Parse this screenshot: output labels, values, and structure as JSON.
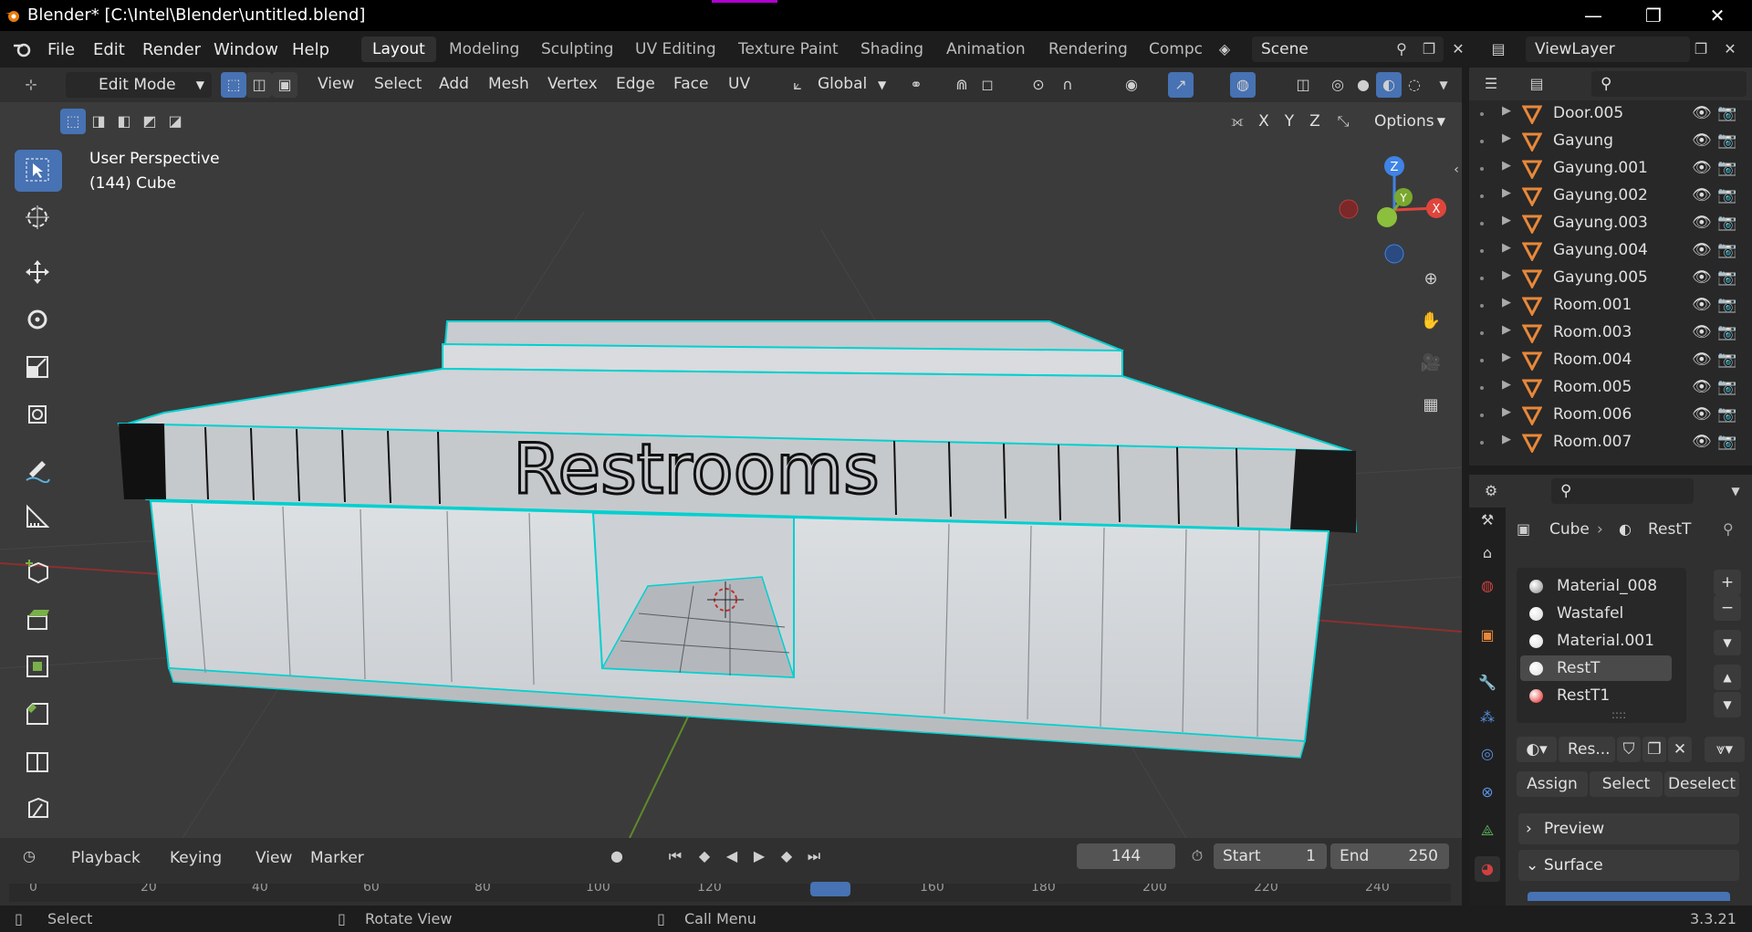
{
  "window": {
    "title": "Blender* [C:\\Intel\\Blender\\untitled.blend]",
    "minimize": "—",
    "maximize": "❐",
    "close": "✕"
  },
  "menu": [
    "File",
    "Edit",
    "Render",
    "Window",
    "Help"
  ],
  "workspaces": [
    "Layout",
    "Modeling",
    "Sculpting",
    "UV Editing",
    "Texture Paint",
    "Shading",
    "Animation",
    "Rendering",
    "Compc"
  ],
  "active_workspace": "Layout",
  "scene": "Scene",
  "view_layer": "ViewLayer",
  "viewport_header": {
    "mode": "Edit Mode",
    "menus": [
      "View",
      "Select",
      "Add",
      "Mesh",
      "Vertex",
      "Edge",
      "Face",
      "UV"
    ],
    "transform_orientation": "Global",
    "options": "Options",
    "axes": [
      "X",
      "Y",
      "Z"
    ]
  },
  "viewport": {
    "perspective": "User Perspective",
    "object": "(144) Cube",
    "sign_text": "Restrooms",
    "gizmo": {
      "x": "X",
      "y": "Y",
      "z": "Z"
    }
  },
  "outliner": {
    "items": [
      "Door.005",
      "Gayung",
      "Gayung.001",
      "Gayung.002",
      "Gayung.003",
      "Gayung.004",
      "Gayung.005",
      "Room.001",
      "Room.003",
      "Room.004",
      "Room.005",
      "Room.006",
      "Room.007"
    ]
  },
  "properties": {
    "breadcrumb_object": "Cube",
    "breadcrumb_material": "RestT",
    "material_slots": [
      {
        "name": "Material_008",
        "color": "#8a8a8a"
      },
      {
        "name": "Wastafel",
        "color": "#d8d8d8"
      },
      {
        "name": "Material.001",
        "color": "#dcdcdc"
      },
      {
        "name": "RestT",
        "color": "#e0e0e0"
      },
      {
        "name": "RestT1",
        "color": "#e01818"
      }
    ],
    "active_slot": "RestT",
    "material_field": "Res...",
    "assign": "Assign",
    "select": "Select",
    "deselect": "Deselect",
    "panels": [
      "Preview",
      "Surface"
    ]
  },
  "timeline": {
    "menus": [
      "Playback",
      "Keying",
      "View",
      "Marker"
    ],
    "current_frame": "144",
    "start_label": "Start",
    "start": "1",
    "end_label": "End",
    "end": "250",
    "ruler": [
      "0",
      "20",
      "40",
      "60",
      "80",
      "100",
      "120",
      "140",
      "160",
      "180",
      "200",
      "220",
      "240"
    ]
  },
  "statusbar": {
    "select": "Select",
    "rotate": "Rotate View",
    "call_menu": "Call Menu",
    "version": "3.3.21"
  },
  "colors": {
    "accent_blue": "#4772b3",
    "mesh_highlight": "#00d0d0",
    "outliner_icon": "#e8883a",
    "axis_x": "#e0453c",
    "axis_y": "#7aa82f",
    "axis_z": "#3f83e6"
  }
}
